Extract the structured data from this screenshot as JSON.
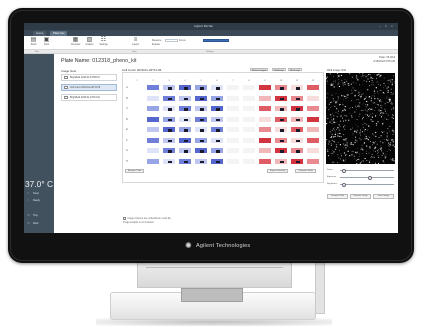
{
  "window": {
    "title": "Agilent BioTek",
    "controls": [
      "–",
      "□",
      "×"
    ]
  },
  "tabs": [
    {
      "label": "Home"
    },
    {
      "label": "Plate Set",
      "active": true
    }
  ],
  "ribbon": {
    "buttons": [
      {
        "icon": "▤",
        "label": "Read"
      },
      {
        "icon": "▣",
        "label": "Scan"
      },
      {
        "icon": "▦",
        "label": "Overview"
      },
      {
        "icon": "▧",
        "label": "Analyze"
      },
      {
        "icon": "☷",
        "label": "Settings"
      },
      {
        "icon": "≡",
        "label": "Layout"
      }
    ],
    "fields": [
      {
        "label": "Measure"
      },
      {
        "label": "Expose"
      },
      {
        "label": "Focus"
      }
    ],
    "groups": [
      "Run",
      "Data",
      "Settings"
    ]
  },
  "sidebar": {
    "temperature": "37.0° C",
    "status": [
      {
        "icon": "○",
        "label": "Temp"
      },
      {
        "icon": "○",
        "label": "Ready"
      },
      {
        "icon": "▭",
        "label": "Tray"
      },
      {
        "icon": "▭",
        "label": "Dock"
      }
    ]
  },
  "plate": {
    "name_label": "Plate Name:",
    "name_value": "012318_pheno_kit",
    "info": [
      "Plate: 96 Well",
      "2/18/2018 9:55 AM"
    ]
  },
  "image_sets": {
    "label": "Image Sets",
    "items": [
      {
        "text": "Brightfield 2018-01-23T09:15",
        "selected": false
      },
      {
        "text": "Cell Count 2018-01-23T11:06",
        "selected": true
      },
      {
        "text": "Brightfield 2018-01-23T14:02",
        "selected": false
      }
    ]
  },
  "plate_view": {
    "title": "Cell Count 2018-01-23T11:06",
    "toolbar": [
      "Show Images",
      "Heatmap",
      "96 Group"
    ],
    "columns": [
      "1",
      "2",
      "3",
      "4",
      "5",
      "6",
      "7",
      "8",
      "9",
      "10",
      "11",
      "12"
    ],
    "rows": [
      "A",
      "B",
      "C",
      "D",
      "E",
      "F",
      "G",
      "H"
    ],
    "buttons_left": [
      "Analyze Plate"
    ],
    "buttons_right": [
      "Export Selected",
      "Compare Wells"
    ],
    "footnotes": [
      "Image columns are embedded in result file",
      "Image analysis is not included"
    ]
  },
  "well_preview": {
    "title": "Well Image: D10",
    "sliders": [
      {
        "label": "Zoom",
        "level": 0.05
      },
      {
        "label": "Exposure",
        "level": 0.55
      },
      {
        "label": "Brightness",
        "level": 0.05
      }
    ],
    "buttons": [
      "Compare Well",
      "Remove Image",
      "Save Image"
    ]
  },
  "brand": {
    "name": "Agilent Technologies",
    "logo_icon": "agilent-spark-icon"
  },
  "colors": {
    "screen_bg": "#ffffff",
    "sidebar": "#42515e",
    "accent": "#3d6bb2",
    "heat_blue": "#4a5fc8",
    "heat_red": "#d2343f"
  }
}
